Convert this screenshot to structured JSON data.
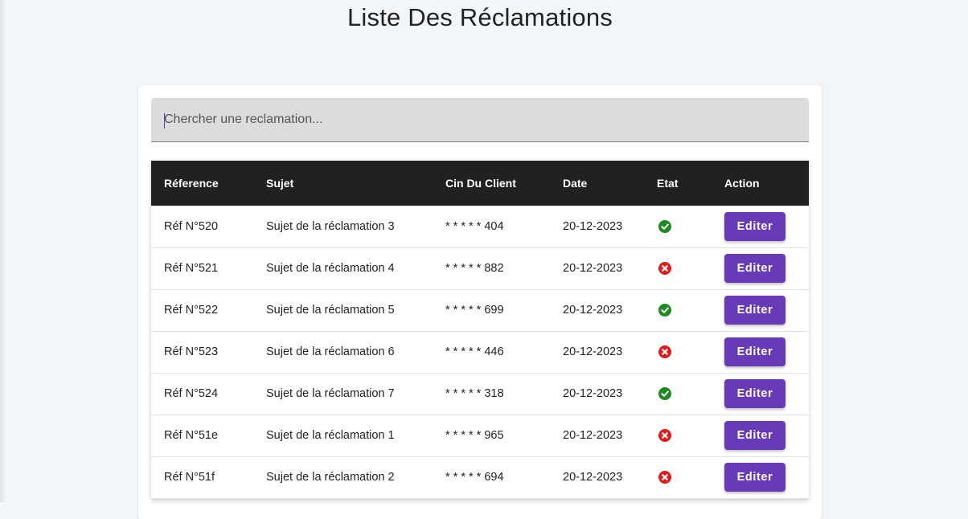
{
  "page": {
    "title": "Liste Des Réclamations"
  },
  "search": {
    "placeholder": "Chercher une reclamation...",
    "value": ""
  },
  "table": {
    "headers": [
      "Réference",
      "Sujet",
      "Cin Du Client",
      "Date",
      "Etat",
      "Action"
    ],
    "rows": [
      {
        "reference": "Réf N°520",
        "sujet": "Sujet de la réclamation 3",
        "cin": "* * * * * 404",
        "date": "20-12-2023",
        "etat": "ok",
        "action": "Editer"
      },
      {
        "reference": "Réf N°521",
        "sujet": "Sujet de la réclamation 4",
        "cin": "* * * * * 882",
        "date": "20-12-2023",
        "etat": "rejected",
        "action": "Editer"
      },
      {
        "reference": "Réf N°522",
        "sujet": "Sujet de la réclamation 5",
        "cin": "* * * * * 699",
        "date": "20-12-2023",
        "etat": "ok",
        "action": "Editer"
      },
      {
        "reference": "Réf N°523",
        "sujet": "Sujet de la réclamation 6",
        "cin": "* * * * * 446",
        "date": "20-12-2023",
        "etat": "rejected",
        "action": "Editer"
      },
      {
        "reference": "Réf N°524",
        "sujet": "Sujet de la réclamation 7",
        "cin": "* * * * * 318",
        "date": "20-12-2023",
        "etat": "ok",
        "action": "Editer"
      },
      {
        "reference": "Réf N°51e",
        "sujet": "Sujet de la réclamation 1",
        "cin": "* * * * * 965",
        "date": "20-12-2023",
        "etat": "rejected",
        "action": "Editer"
      },
      {
        "reference": "Réf N°51f",
        "sujet": "Sujet de la réclamation 2",
        "cin": "* * * * * 694",
        "date": "20-12-2023",
        "etat": "rejected",
        "action": "Editer"
      }
    ]
  },
  "icons": {
    "ok": "check-circle-icon",
    "rejected": "cancel-circle-icon"
  },
  "colors": {
    "header_bg": "#212121",
    "button_bg": "#673ab7",
    "status_ok": "#1e8a1e",
    "status_rejected": "#e01b1b",
    "page_bg": "#f3f6f9"
  }
}
